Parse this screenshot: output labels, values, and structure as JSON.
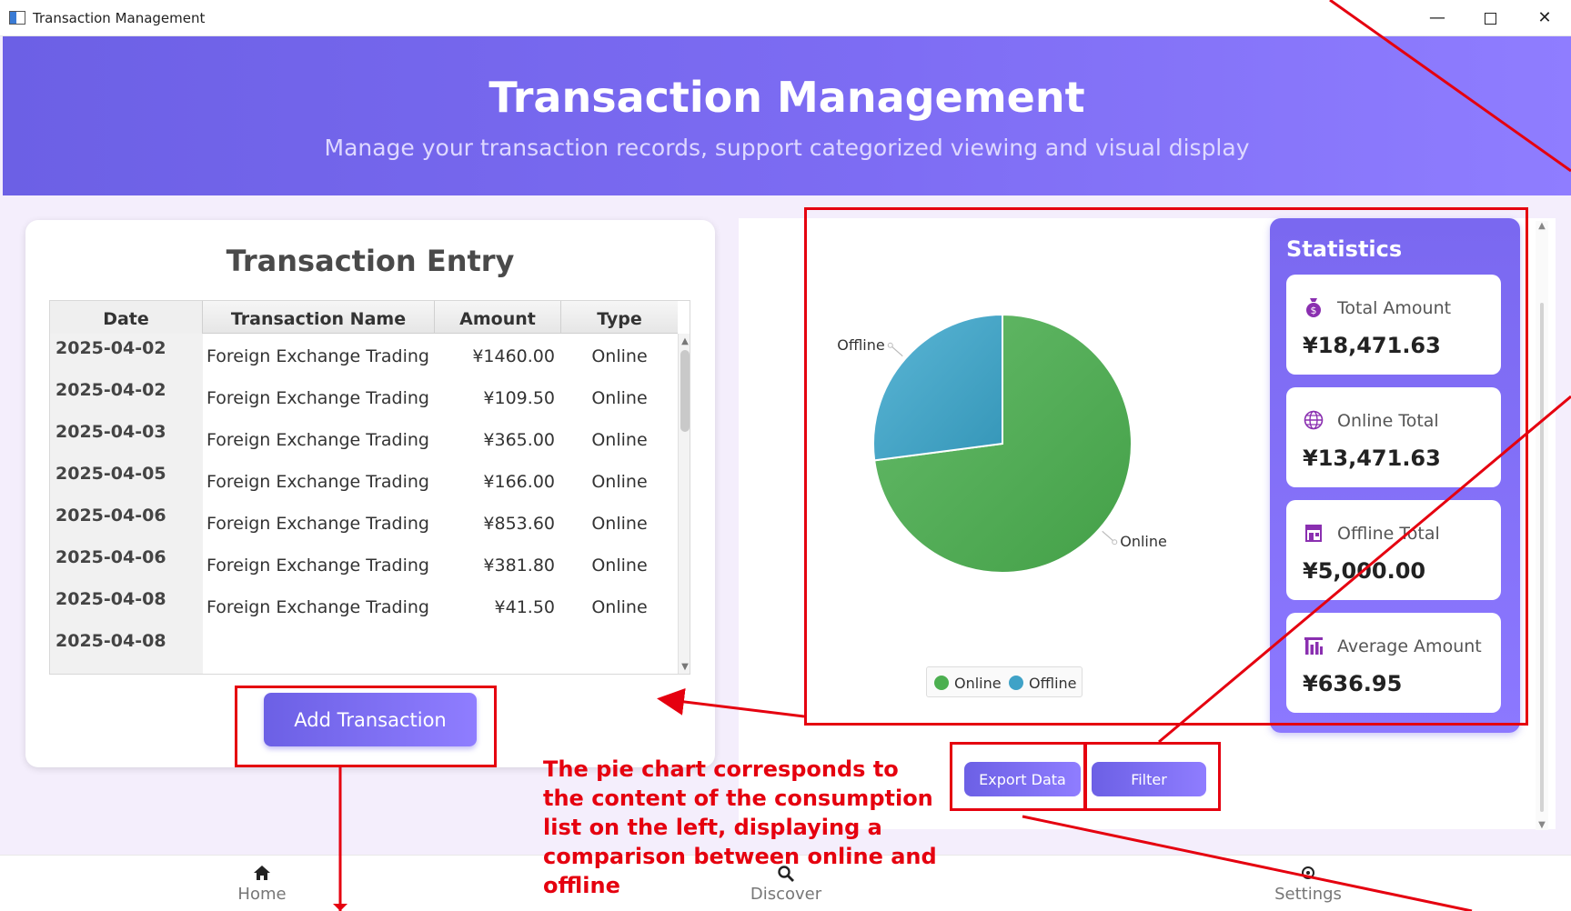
{
  "window": {
    "title": "Transaction Management",
    "minimize": "—",
    "close": "✕"
  },
  "header": {
    "title": "Transaction Management",
    "subtitle": "Manage your transaction records, support categorized viewing and visual display"
  },
  "entry": {
    "title": "Transaction Entry",
    "columns": [
      "Date",
      "Transaction Name",
      "Amount",
      "Type"
    ],
    "rows": [
      {
        "date": "2025-04-02",
        "name": "Foreign Exchange Trading",
        "amount": "¥1460.00",
        "type": "Online"
      },
      {
        "date": "2025-04-02",
        "name": "Foreign Exchange Trading",
        "amount": "¥109.50",
        "type": "Online"
      },
      {
        "date": "2025-04-03",
        "name": "Foreign Exchange Trading",
        "amount": "¥365.00",
        "type": "Online"
      },
      {
        "date": "2025-04-05",
        "name": "Foreign Exchange Trading",
        "amount": "¥166.00",
        "type": "Online"
      },
      {
        "date": "2025-04-06",
        "name": "Foreign Exchange Trading",
        "amount": "¥853.60",
        "type": "Online"
      },
      {
        "date": "2025-04-06",
        "name": "Foreign Exchange Trading",
        "amount": "¥381.80",
        "type": "Online"
      },
      {
        "date": "2025-04-08",
        "name": "Foreign Exchange Trading",
        "amount": "¥41.50",
        "type": "Online"
      },
      {
        "date": "2025-04-08",
        "name": "",
        "amount": "",
        "type": ""
      }
    ],
    "add_button": "Add Transaction"
  },
  "chart_data": {
    "type": "pie",
    "categories": [
      "Online",
      "Offline"
    ],
    "values": [
      13471.63,
      5000.0
    ],
    "colors": [
      "#4caf50",
      "#3fa2c7"
    ],
    "legend": "bottom"
  },
  "legend": {
    "online": "Online",
    "offline": "Offline"
  },
  "stats": {
    "title": "Statistics",
    "items": [
      {
        "icon": "money-bag-icon",
        "label": "Total Amount",
        "value": "¥18,471.63"
      },
      {
        "icon": "globe-icon",
        "label": "Online Total",
        "value": "¥13,471.63"
      },
      {
        "icon": "store-icon",
        "label": "Offline Total",
        "value": "¥5,000.00"
      },
      {
        "icon": "bar-chart-icon",
        "label": "Average Amount",
        "value": "¥636.95"
      }
    ]
  },
  "actions": {
    "export": "Export Data",
    "filter": "Filter"
  },
  "nav": {
    "home": "Home",
    "discover": "Discover",
    "settings": "Settings"
  },
  "annotation": {
    "text": "The pie chart corresponds to the content of the consumption list on the left, displaying a comparison between online and offline",
    "color": "#e5000f"
  }
}
